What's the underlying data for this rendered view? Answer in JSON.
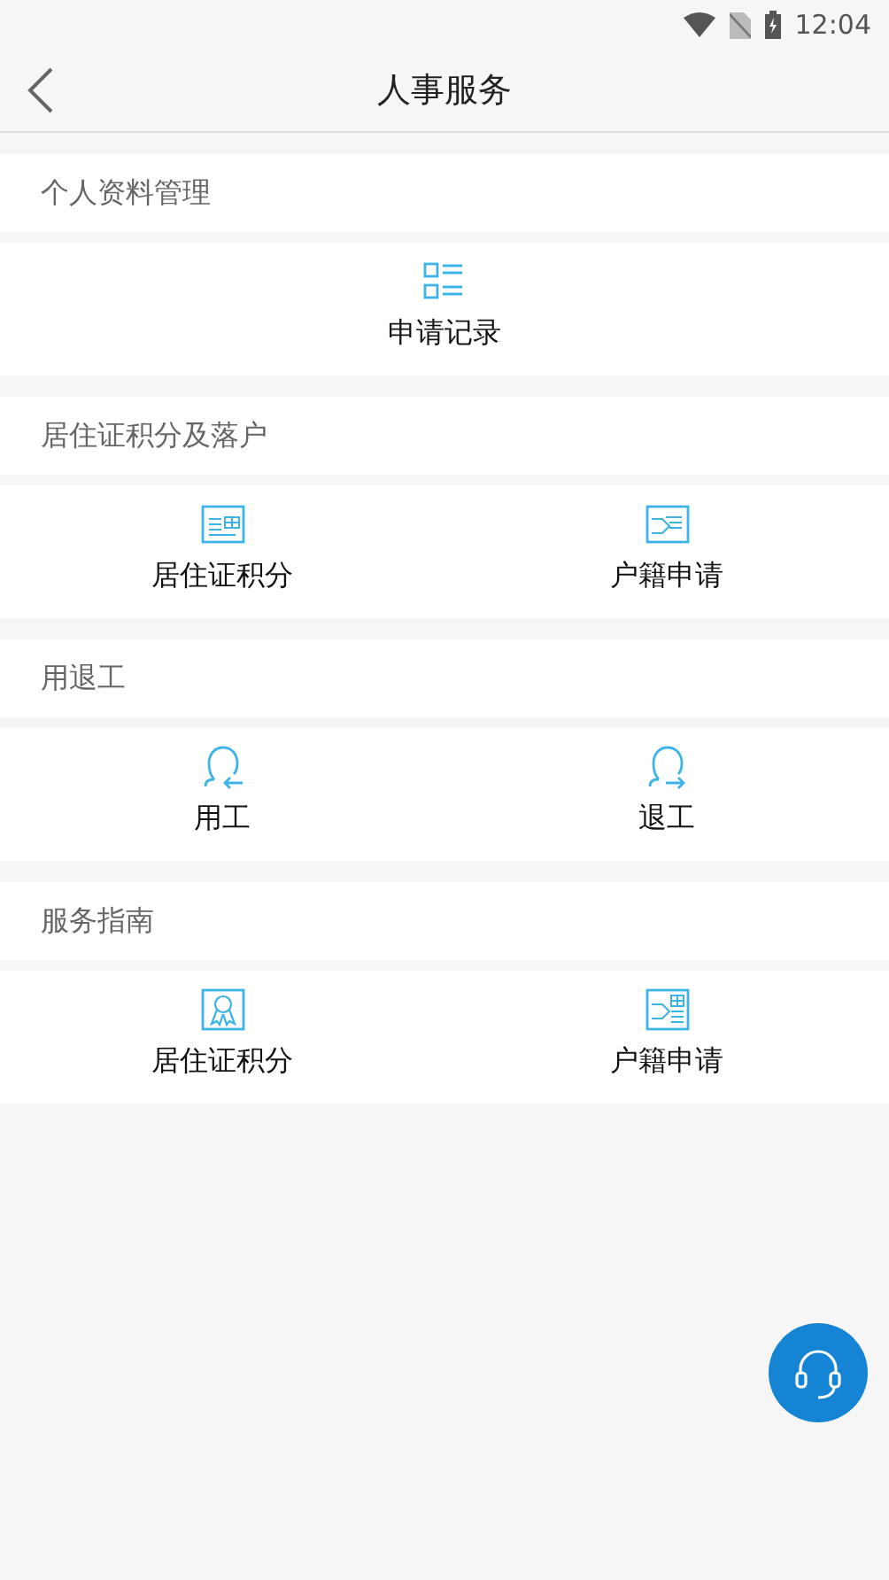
{
  "status_bar": {
    "time": "12:04"
  },
  "header": {
    "title": "人事服务"
  },
  "sections": [
    {
      "title": "个人资料管理",
      "items": [
        {
          "label": "申请记录",
          "kind": "list"
        }
      ]
    },
    {
      "title": "居住证积分及落户",
      "items": [
        {
          "label": "居住证积分",
          "kind": "scorecard"
        },
        {
          "label": "户籍申请",
          "kind": "transfer"
        }
      ]
    },
    {
      "title": "用退工",
      "items": [
        {
          "label": "用工",
          "kind": "hire"
        },
        {
          "label": "退工",
          "kind": "leave"
        }
      ]
    },
    {
      "title": "服务指南",
      "items": [
        {
          "label": "居住证积分",
          "kind": "award"
        },
        {
          "label": "户籍申请",
          "kind": "transfer88"
        }
      ]
    }
  ]
}
